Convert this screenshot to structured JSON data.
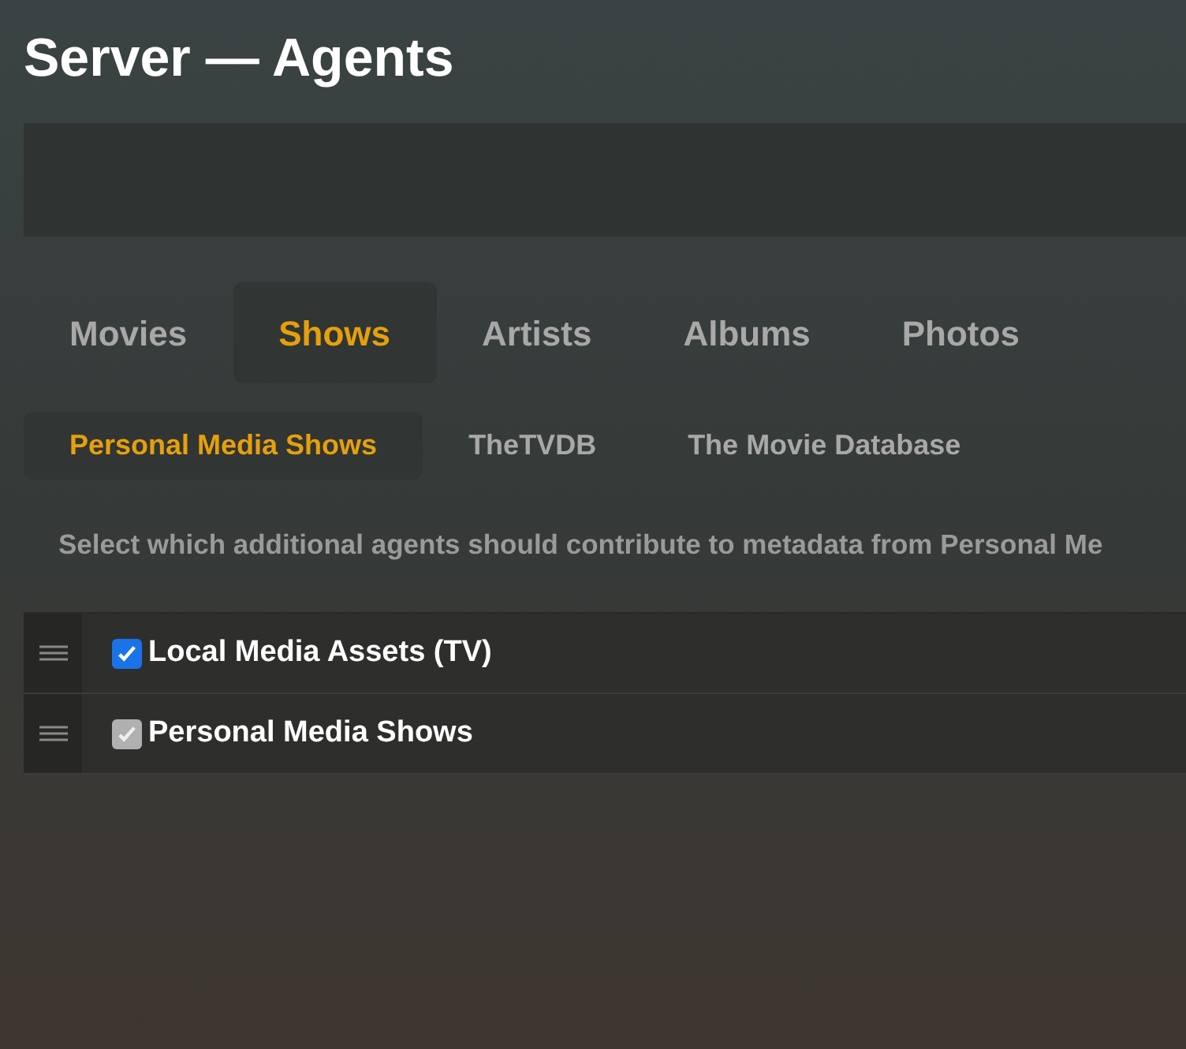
{
  "title": "Server — Agents",
  "tabs": [
    {
      "label": "Movies",
      "selected": false
    },
    {
      "label": "Shows",
      "selected": true
    },
    {
      "label": "Artists",
      "selected": false
    },
    {
      "label": "Albums",
      "selected": false
    },
    {
      "label": "Photos",
      "selected": false
    }
  ],
  "subtabs": [
    {
      "label": "Personal Media Shows",
      "selected": true
    },
    {
      "label": "TheTVDB",
      "selected": false
    },
    {
      "label": "The Movie Database",
      "selected": false
    }
  ],
  "description": "Select which additional agents should contribute to metadata from Personal Me",
  "agents": [
    {
      "label": "Local Media Assets (TV)",
      "checked": true,
      "disabled": false
    },
    {
      "label": "Personal Media Shows",
      "checked": true,
      "disabled": true
    }
  ]
}
